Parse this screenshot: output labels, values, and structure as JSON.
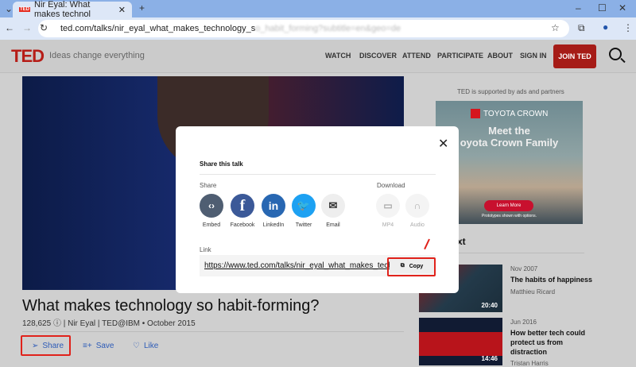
{
  "browser": {
    "tab_title": "Nir Eyal: What makes technol",
    "url_visible": "ted.com/talks/nir_eyal_what_makes_technology_s",
    "url_blurred": "o_habit_forming?subtitle=en&geo=de"
  },
  "nav": {
    "logo": "TED",
    "tagline": "Ideas change everything",
    "links": [
      "WATCH",
      "DISCOVER",
      "ATTEND",
      "PARTICIPATE",
      "ABOUT",
      "SIGN IN"
    ],
    "join": "JOIN TED"
  },
  "talk": {
    "title": "What makes technology so habit-forming?",
    "views": "128,625",
    "meta": "| Nir Eyal | TED@IBM • October 2015",
    "actions": {
      "share": "Share",
      "save": "Save",
      "like": "Like"
    }
  },
  "ad": {
    "note": "TED is supported by ads and partners",
    "brand": "TOYOTA CROWN",
    "line1": "Meet the",
    "line2": "oyota Crown Family",
    "cta": "Learn More",
    "disclaimer": "Prototypes shown with options."
  },
  "upnext": {
    "heading": "xt",
    "items": [
      {
        "date": "Nov 2007",
        "title": "The habits of happiness",
        "author": "Matthieu Ricard",
        "duration": "20:40"
      },
      {
        "date": "Jun 2016",
        "title": "How better tech could protect us from distraction",
        "author": "Tristan Harris",
        "duration": "14:46"
      }
    ]
  },
  "modal": {
    "title": "Share this talk",
    "share_label": "Share",
    "download_label": "Download",
    "share_options": [
      "Embed",
      "Facebook",
      "LinkedIn",
      "Twitter",
      "Email"
    ],
    "download_options": [
      "MP4",
      "Audio"
    ],
    "link_label": "Link",
    "link": "https://www.ted.com/talks/nir_eyal_what_makes_technology_so_habit_forming",
    "copy": "Copy"
  },
  "colors": {
    "ted_red": "#a61c17",
    "highlight": "#e0221b",
    "link_blue": "#2d5bb7"
  }
}
